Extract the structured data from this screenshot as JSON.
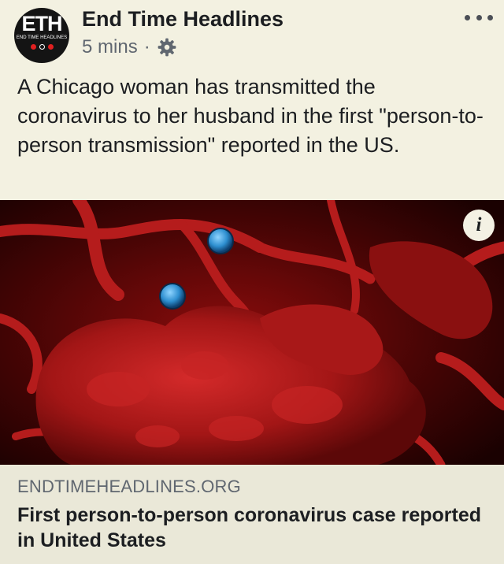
{
  "post": {
    "page_name": "End Time Headlines",
    "avatar": {
      "letters": "ETH",
      "subtitle": "END TIME HEADLINES"
    },
    "timestamp": "5 mins",
    "separator": "·",
    "privacy_icon": "gear-icon",
    "menu_icon": "more-dots-icon",
    "text": "A Chicago woman has transmitted the coronavirus to her husband in the first \"person-to-person transmission\" reported in the US."
  },
  "link_preview": {
    "image_icon": "info-icon",
    "info_label": "i",
    "domain": "ENDTIMEHEADLINES.ORG",
    "title": "First person-to-person coronavirus case reported in United States"
  },
  "colors": {
    "background": "#f3f1e1",
    "caption_background": "#eae8d8",
    "virus_red": "#b01818",
    "virus_blue": "#3a9ad8"
  }
}
